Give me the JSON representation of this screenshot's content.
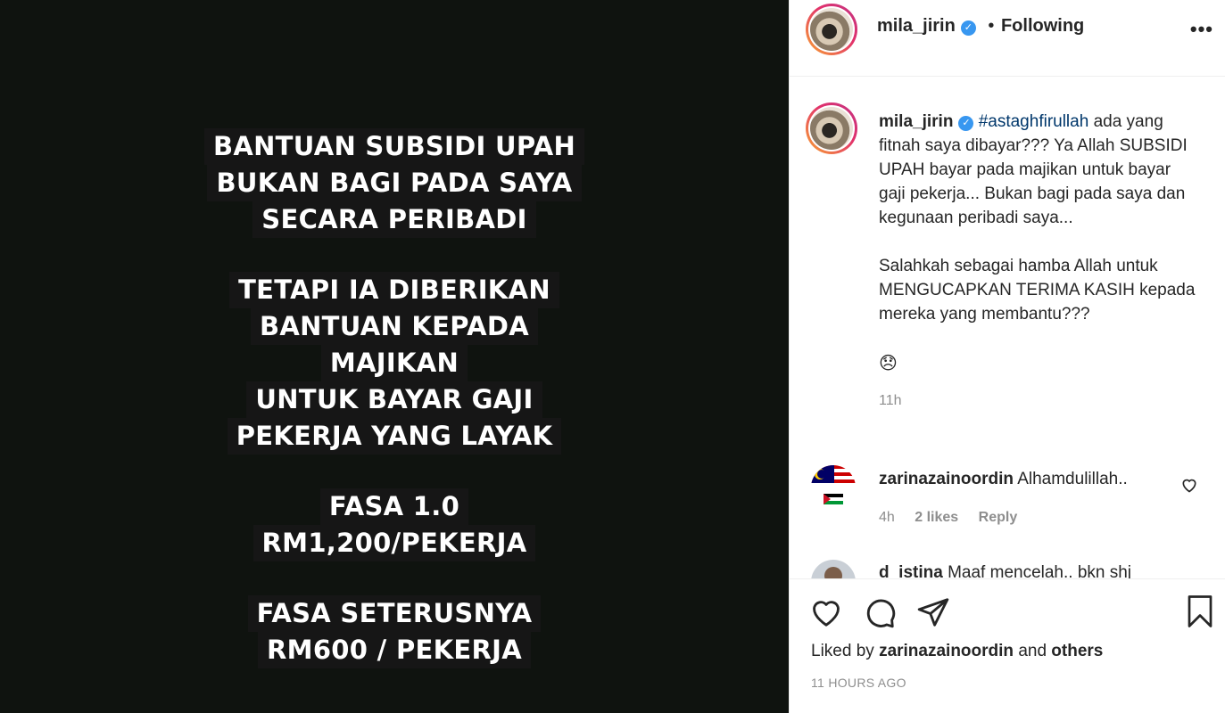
{
  "media": {
    "blocks": [
      [
        "BANTUAN SUBSIDI UPAH",
        "BUKAN BAGI PADA SAYA",
        "SECARA PERIBADI"
      ],
      [
        "TETAPI IA DIBERIKAN",
        "BANTUAN KEPADA",
        "MAJIKAN",
        "UNTUK BAYAR GAJI",
        "PEKERJA YANG LAYAK"
      ],
      [
        "FASA 1.0",
        "RM1,200/PEKERJA"
      ],
      [
        "FASA SETERUSNYA",
        "RM600 / PEKERJA"
      ]
    ]
  },
  "header": {
    "username": "mila_jirin",
    "separator": "•",
    "follow_status": "Following",
    "more": "•••"
  },
  "caption": {
    "username": "mila_jirin",
    "hashtag": "#astaghfirullah",
    "text_part1": " ada yang fitnah saya dibayar??? Ya Allah SUBSIDI UPAH bayar pada majikan untuk bayar gaji pekerja... Bukan bagi pada saya dan kegunaan peribadi saya...",
    "text_part2": "Salahkah sebagai hamba Allah untuk MENGUCAPKAN TERIMA KASIH kepada mereka yang membantu???",
    "emoji": "😞",
    "time": "11h"
  },
  "comments": [
    {
      "username": "zarinazainoordin",
      "text": "Alhamdulillah..",
      "time": "4h",
      "likes": "2 likes",
      "reply": "Reply"
    },
    {
      "username": "d_istina",
      "text": "Maaf mencelah.. bkn shj",
      "time": "",
      "likes": "",
      "reply": ""
    }
  ],
  "footer": {
    "liked_prefix": "Liked by",
    "liked_user": "zarinazainoordin",
    "liked_and": "and",
    "liked_others": "others",
    "timestamp": "11 HOURS AGO"
  },
  "colors": {
    "media_bg": "#0f130f",
    "text_primary": "#262626",
    "text_muted": "#8e8e8e",
    "link": "#00376b",
    "verified": "#3897f0"
  }
}
